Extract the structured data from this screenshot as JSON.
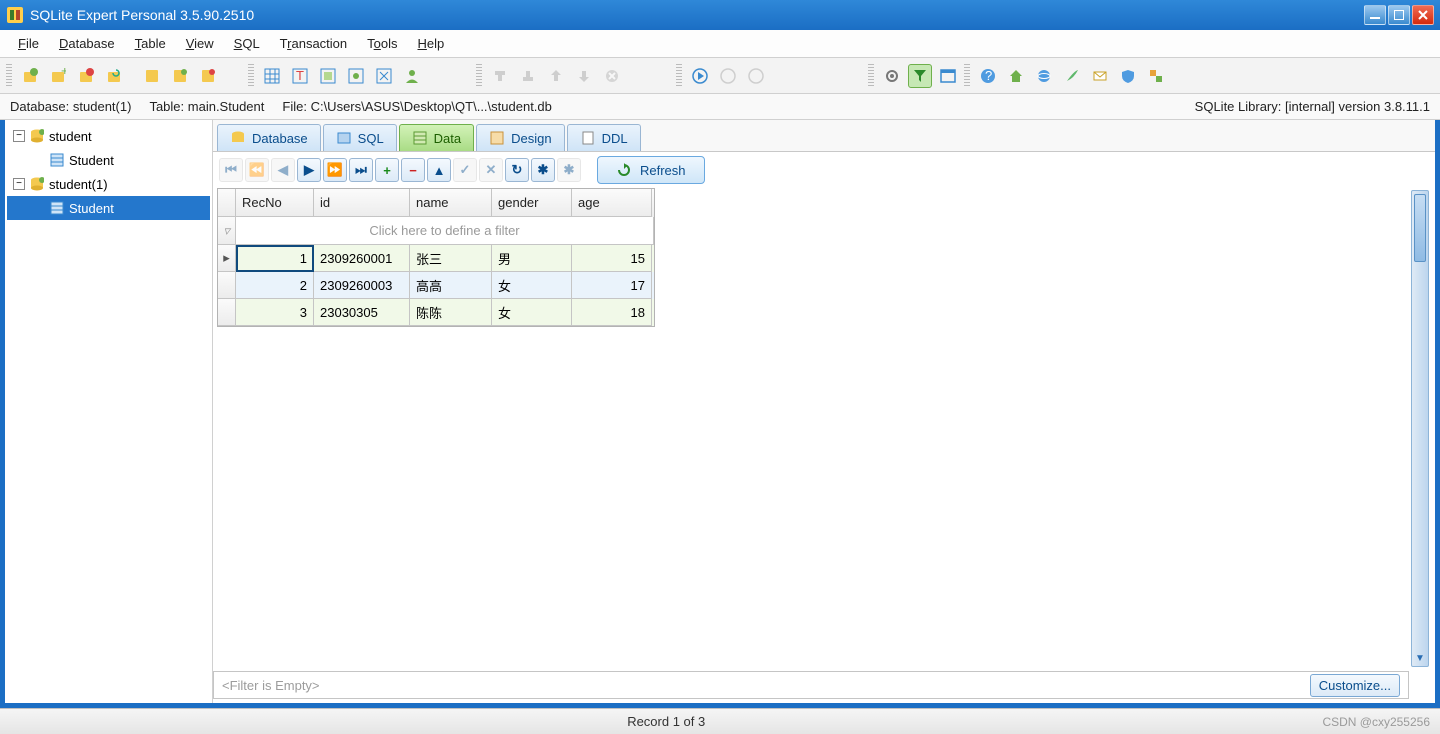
{
  "window": {
    "title": "SQLite Expert Personal 3.5.90.2510"
  },
  "menu": {
    "file": "File",
    "database": "Database",
    "table": "Table",
    "view": "View",
    "sql": "SQL",
    "transaction": "Transaction",
    "tools": "Tools",
    "help": "Help"
  },
  "info": {
    "db_label": "Database:",
    "db": "student(1)",
    "tbl_label": "Table:",
    "tbl": "main.Student",
    "file_label": "File:",
    "file": "C:\\Users\\ASUS\\Desktop\\QT\\...\\student.db",
    "lib": "SQLite Library: [internal] version 3.8.11.1"
  },
  "tree": {
    "db1": "student",
    "db1_tbl": "Student",
    "db2": "student(1)",
    "db2_tbl": "Student"
  },
  "tabs": {
    "database": "Database",
    "sql": "SQL",
    "data": "Data",
    "design": "Design",
    "ddl": "DDL"
  },
  "nav": {
    "refresh": "Refresh"
  },
  "grid": {
    "cols": {
      "rec": "RecNo",
      "id": "id",
      "name": "name",
      "gender": "gender",
      "age": "age"
    },
    "filter_hint": "Click here to define a filter",
    "rows": [
      {
        "rec": "1",
        "id": "2309260001",
        "name": "张三",
        "gender": "男",
        "age": "15"
      },
      {
        "rec": "2",
        "id": "2309260003",
        "name": "高高",
        "gender": "女",
        "age": "17"
      },
      {
        "rec": "3",
        "id": "23030305",
        "name": "陈陈",
        "gender": "女",
        "age": "18"
      }
    ],
    "filter_empty": "<Filter is Empty>",
    "customize": "Customize..."
  },
  "status": {
    "record": "Record 1 of 3",
    "watermark": "CSDN @cxy255256"
  }
}
